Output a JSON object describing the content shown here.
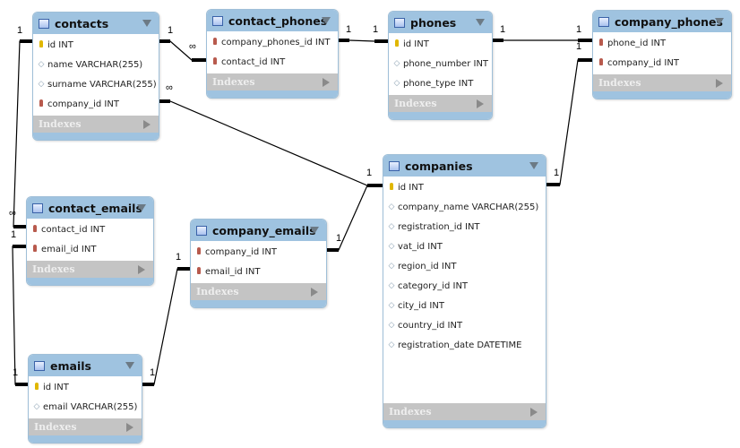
{
  "indexes_label": "Indexes",
  "tables": [
    {
      "id": "contacts",
      "name": "contacts",
      "columns": [
        {
          "text": "id INT",
          "key": "pk"
        },
        {
          "text": "name VARCHAR(255)",
          "key": "attr"
        },
        {
          "text": "surname VARCHAR(255)",
          "key": "attr"
        },
        {
          "text": "company_id INT",
          "key": "fk"
        }
      ]
    },
    {
      "id": "contact_phones",
      "name": "contact_phones",
      "columns": [
        {
          "text": "company_phones_id INT",
          "key": "fk"
        },
        {
          "text": "contact_id INT",
          "key": "fk"
        }
      ]
    },
    {
      "id": "phones",
      "name": "phones",
      "columns": [
        {
          "text": "id INT",
          "key": "pk"
        },
        {
          "text": "phone_number INT",
          "key": "attr"
        },
        {
          "text": "phone_type INT",
          "key": "attr"
        }
      ]
    },
    {
      "id": "company_phones",
      "name": "company_phones",
      "columns": [
        {
          "text": "phone_id INT",
          "key": "fk"
        },
        {
          "text": "company_id INT",
          "key": "fk"
        }
      ]
    },
    {
      "id": "companies",
      "name": "companies",
      "columns": [
        {
          "text": "id INT",
          "key": "pk"
        },
        {
          "text": "company_name VARCHAR(255)",
          "key": "attr"
        },
        {
          "text": "registration_id INT",
          "key": "attr"
        },
        {
          "text": "vat_id INT",
          "key": "attr"
        },
        {
          "text": "region_id INT",
          "key": "attr"
        },
        {
          "text": "category_id INT",
          "key": "attr"
        },
        {
          "text": "city_id INT",
          "key": "attr"
        },
        {
          "text": "country_id INT",
          "key": "attr"
        },
        {
          "text": "registration_date DATETIME",
          "key": "attr"
        }
      ]
    },
    {
      "id": "contact_emails",
      "name": "contact_emails",
      "columns": [
        {
          "text": "contact_id INT",
          "key": "fk"
        },
        {
          "text": "email_id INT",
          "key": "fk"
        }
      ]
    },
    {
      "id": "company_emails",
      "name": "company_emails",
      "columns": [
        {
          "text": "company_id INT",
          "key": "fk"
        },
        {
          "text": "email_id INT",
          "key": "fk"
        }
      ]
    },
    {
      "id": "emails",
      "name": "emails",
      "columns": [
        {
          "text": "id INT",
          "key": "pk"
        },
        {
          "text": "email VARCHAR(255)",
          "key": "attr"
        }
      ]
    }
  ],
  "relationships": [
    {
      "from": "contacts",
      "to": "contact_emails",
      "from_card": "1",
      "to_card": "∞"
    },
    {
      "from": "emails",
      "to": "contact_emails",
      "from_card": "1",
      "to_card": "1"
    },
    {
      "from": "contacts",
      "to": "contact_phones",
      "from_card": "1",
      "to_card": "∞"
    },
    {
      "from": "companies",
      "to": "contacts",
      "from_card": "1",
      "to_card": "∞"
    },
    {
      "from": "contact_phones",
      "to": "phones",
      "from_card": "1",
      "to_card": "1"
    },
    {
      "from": "phones",
      "to": "company_phones",
      "from_card": "1",
      "to_card": "1"
    },
    {
      "from": "companies",
      "to": "company_phones",
      "from_card": "1",
      "to_card": "1"
    },
    {
      "from": "companies",
      "to": "company_emails",
      "from_card": "1",
      "to_card": "1"
    },
    {
      "from": "emails",
      "to": "company_emails",
      "from_card": "1",
      "to_card": "1"
    }
  ]
}
